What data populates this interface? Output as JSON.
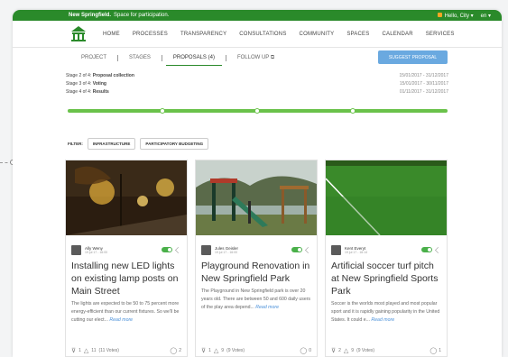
{
  "topbar": {
    "city": "New Springfield.",
    "tagline": "Space for participation.",
    "greeting": "Hello, City ▾",
    "lang": "en ▾"
  },
  "nav": {
    "items": [
      "HOME",
      "PROCESSES",
      "TRANSPARENCY",
      "CONSULTATIONS",
      "COMMUNITY",
      "SPACES",
      "CALENDAR",
      "SERVICES"
    ]
  },
  "subnav": {
    "tabs": [
      "PROJECT",
      "STAGES",
      "PROPOSALS (4)",
      "FOLLOW UP ⧉"
    ],
    "suggest_label": "SUGGEST PROPOSAL"
  },
  "stages": [
    {
      "prefix": "Stage 2 of 4:",
      "name": "Proposal collection",
      "dates": "15/01/2017 - 31/12/2017"
    },
    {
      "prefix": "Stage 3 of 4:",
      "name": "Voting",
      "dates": "15/01/2017 - 30/11/2017"
    },
    {
      "prefix": "Stage 4 of 4:",
      "name": "Results",
      "dates": "01/11/2017 - 31/12/2017"
    }
  ],
  "progress": {
    "fraction": 1.0
  },
  "filters": {
    "label": "FILTER:",
    "chips": [
      "INFRASTRUCTURE",
      "PARTICIPATORY BUDGETING"
    ]
  },
  "cards": [
    {
      "author": "Ally Weny",
      "date": "19 jul 17 - 16:00",
      "title": "Installing new LED lights on existing lamp posts on Main Street",
      "body": "The lights are expected to be 50 to 75 percent more energy-efficient than our current fixtures. So we'll be cutting our elect...",
      "more": "Read more",
      "dislikes": "1",
      "likes": "11",
      "votes": "(11 Votes)",
      "comments": "2"
    },
    {
      "author": "Jules Geisler",
      "date": "19 jul 17 - 16:00",
      "title": "Playground Renovation in New Springfield Park",
      "body": "The Playground in New Springfield park is over 20 years old. There are between 50 and 600 daily users of the play area depend...",
      "more": "Read more",
      "dislikes": "1",
      "likes": "9",
      "votes": "(9 Votes)",
      "comments": "0"
    },
    {
      "author": "Kent Everyt",
      "date": "19 jul 17 - 16:14",
      "title": "Artificial soccer turf pitch at New Springfield Sports Park",
      "body": "Soccer is the worlds most played and most popular sport and it is rapidly gaining popularity in the United States. It could e...",
      "more": "Read more",
      "dislikes": "2",
      "likes": "9",
      "votes": "(9 Votes)",
      "comments": "1"
    }
  ]
}
